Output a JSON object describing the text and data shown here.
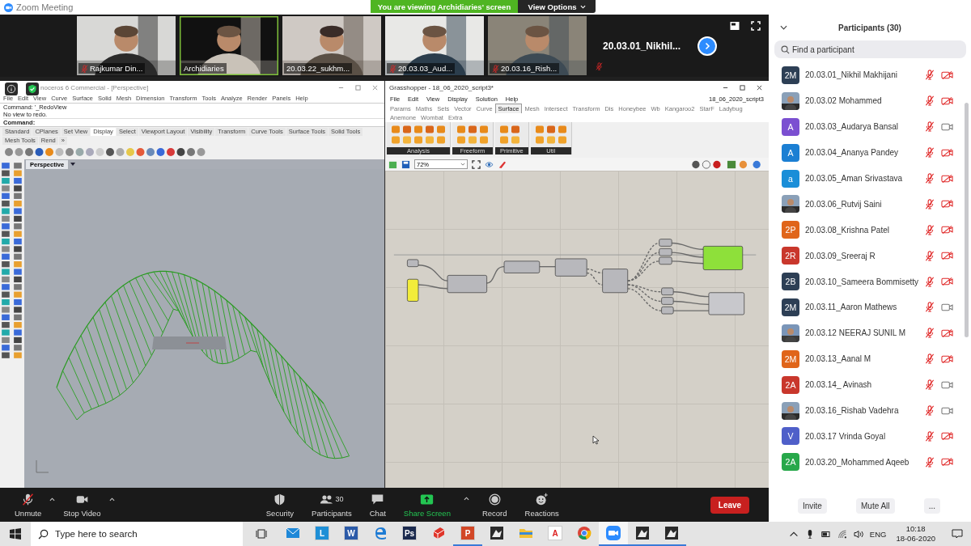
{
  "window": {
    "title": "Zoom Meeting"
  },
  "share_banner": {
    "text": "You are viewing Archidiaries' screen",
    "options": "View Options"
  },
  "video_tiles": [
    {
      "kind": "video",
      "name": "Rajkumar Din...",
      "muted": true,
      "speaking": false
    },
    {
      "kind": "video",
      "name": "Archidiaries",
      "muted": false,
      "speaking": true
    },
    {
      "kind": "video",
      "name": "20.03.22_sukhm...",
      "muted": false,
      "speaking": false
    },
    {
      "kind": "video",
      "name": "20.03.03_Aud...",
      "muted": true,
      "speaking": false
    },
    {
      "kind": "video",
      "name": "20.03.16_Rish...",
      "muted": true,
      "speaking": false
    },
    {
      "kind": "name",
      "name": "20.03.01_Nikhil...",
      "muted": true,
      "speaking": false
    }
  ],
  "rhino": {
    "title": "noceros 6 Commercial - [Perspective]",
    "menu": [
      "File",
      "Edit",
      "View",
      "Curve",
      "Surface",
      "Solid",
      "Mesh",
      "Dimension",
      "Transform",
      "Tools",
      "Analyze",
      "Render",
      "Panels",
      "Help"
    ],
    "command_history": [
      "Command: '_RedoView",
      "No view to redo."
    ],
    "command_prompt": "Command:",
    "tabs": [
      {
        "label": "Standard",
        "selected": false
      },
      {
        "label": "CPlanes",
        "selected": false
      },
      {
        "label": "Set View",
        "selected": false
      },
      {
        "label": "Display",
        "selected": true
      },
      {
        "label": "Select",
        "selected": false
      },
      {
        "label": "Viewport Layout",
        "selected": false
      },
      {
        "label": "Visibility",
        "selected": false
      },
      {
        "label": "Transform",
        "selected": false
      },
      {
        "label": "Curve Tools",
        "selected": false
      },
      {
        "label": "Surface Tools",
        "selected": false
      },
      {
        "label": "Solid Tools",
        "selected": false
      },
      {
        "label": "Mesh Tools",
        "selected": false
      },
      {
        "label": "Rend",
        "selected": false
      }
    ],
    "tabs_more": "»",
    "viewport": "Perspective"
  },
  "grasshopper": {
    "title": "Grasshopper - 18_06_2020_script3*",
    "menu": [
      "File",
      "Edit",
      "View",
      "Display",
      "Solution",
      "Help"
    ],
    "document": "18_06_2020_script3",
    "tabs": [
      {
        "label": "Params",
        "selected": false
      },
      {
        "label": "Maths",
        "selected": false
      },
      {
        "label": "Sets",
        "selected": false
      },
      {
        "label": "Vector",
        "selected": false
      },
      {
        "label": "Curve",
        "selected": false
      },
      {
        "label": "Surface",
        "selected": true
      },
      {
        "label": "Mesh",
        "selected": false
      },
      {
        "label": "Intersect",
        "selected": false
      },
      {
        "label": "Transform",
        "selected": false
      },
      {
        "label": "Dis",
        "selected": false
      },
      {
        "label": "Honeybee",
        "selected": false
      },
      {
        "label": "Wb",
        "selected": false
      },
      {
        "label": "Kangaroo2",
        "selected": false
      },
      {
        "label": "StarF",
        "selected": false
      },
      {
        "label": "Ladybug",
        "selected": false
      },
      {
        "label": "Anemone",
        "selected": false
      },
      {
        "label": "Wombat",
        "selected": false
      },
      {
        "label": "Extra",
        "selected": false
      }
    ],
    "groups": [
      {
        "label": "Analysis"
      },
      {
        "label": "Freeform"
      },
      {
        "label": "Primitive"
      },
      {
        "label": "Util"
      }
    ],
    "zoom": "72%"
  },
  "meeting_toolbar": {
    "left": [
      {
        "kind": "mic",
        "label": "Unmute",
        "muted": true,
        "caret": true
      },
      {
        "kind": "video",
        "label": "Stop Video",
        "muted": false,
        "caret": true
      }
    ],
    "center": [
      {
        "kind": "security",
        "label": "Security",
        "caret": false
      },
      {
        "kind": "participants",
        "label": "Participants",
        "count": "30",
        "caret": false
      },
      {
        "kind": "chat",
        "label": "Chat",
        "caret": false
      },
      {
        "kind": "share",
        "label": "Share Screen",
        "caret": true
      },
      {
        "kind": "record",
        "label": "Record",
        "caret": false
      },
      {
        "kind": "reactions",
        "label": "Reactions",
        "caret": false
      }
    ],
    "leave": "Leave"
  },
  "participants": {
    "title": "Participants (30)",
    "search_placeholder": "Find a participant",
    "list": [
      {
        "name": "20.03.01_Nikhil Makhijani",
        "avatar": {
          "kind": "initials",
          "text": "2M",
          "color": "#2d3f55"
        },
        "muted": true,
        "video": false
      },
      {
        "name": "20.03.02 Mohammed",
        "muted": true,
        "video": false
      },
      {
        "name": "20.03.03_Audarya Bansal",
        "avatar": {
          "kind": "initials",
          "text": "A",
          "color": "#7b4fd1"
        },
        "muted": true,
        "video": true
      },
      {
        "name": "20.03.04_Ananya Pandey",
        "avatar": {
          "kind": "initials",
          "text": "A",
          "color": "#1b7fd3"
        },
        "muted": true,
        "video": false
      },
      {
        "name": "20.03.05_Aman Srivastava",
        "avatar": {
          "kind": "initials",
          "text": "a",
          "color": "#1a8ed8"
        },
        "muted": true,
        "video": false
      },
      {
        "name": "20.03.06_Rutvij Saini",
        "muted": true,
        "video": false
      },
      {
        "name": "20.03.08_Krishna Patel",
        "avatar": {
          "kind": "initials",
          "text": "2P",
          "color": "#e0651a"
        },
        "muted": true,
        "video": false
      },
      {
        "name": "20.03.09_Sreeraj R",
        "avatar": {
          "kind": "initials",
          "text": "2R",
          "color": "#c9372c"
        },
        "muted": true,
        "video": false
      },
      {
        "name": "20.03.10_Sameera Bommisetty",
        "avatar": {
          "kind": "initials",
          "text": "2B",
          "color": "#2d3f55"
        },
        "muted": true,
        "video": false
      },
      {
        "name": "20.03.11_Aaron Mathews",
        "avatar": {
          "kind": "initials",
          "text": "2M",
          "color": "#2d3f55"
        },
        "muted": true,
        "video": true
      },
      {
        "name": "20.03.12 NEERAJ SUNIL M",
        "muted": true,
        "video": false
      },
      {
        "name": "20.03.13_Aanal M",
        "avatar": {
          "kind": "initials",
          "text": "2M",
          "color": "#e0651a"
        },
        "muted": true,
        "video": false
      },
      {
        "name": "20.03.14_ Avinash",
        "avatar": {
          "kind": "initials",
          "text": "2A",
          "color": "#c9372c"
        },
        "muted": true,
        "video": true
      },
      {
        "name": "20.03.16_Rishab Vadehra",
        "muted": true,
        "video": true
      },
      {
        "name": "20.03.17 Vrinda Goyal",
        "avatar": {
          "kind": "initials",
          "text": "V",
          "color": "#4f5fc9"
        },
        "muted": true,
        "video": false
      },
      {
        "name": "20.03.20_Mohammed Aqeeb",
        "avatar": {
          "kind": "initials",
          "text": "2A",
          "color": "#27a84a"
        },
        "muted": true,
        "video": false
      }
    ],
    "buttons": [
      "Invite",
      "Mute All",
      "..."
    ]
  },
  "taskbar": {
    "search_placeholder": "Type here to search",
    "apps": [
      {
        "kind": "mail",
        "running": false,
        "selected": false
      },
      {
        "kind": "letter",
        "label": "L",
        "color": "#1e8fd6",
        "running": false,
        "selected": false
      },
      {
        "kind": "letter",
        "label": "W",
        "color": "#2b5aa8",
        "running": false,
        "selected": false
      },
      {
        "kind": "edge",
        "running": false,
        "selected": false
      },
      {
        "kind": "letter",
        "label": "Ps",
        "color": "#1b2a4e",
        "running": false,
        "selected": false
      },
      {
        "kind": "sketchup",
        "running": false,
        "selected": false
      },
      {
        "kind": "letter",
        "label": "P",
        "color": "#d24726",
        "running": true,
        "selected": false
      },
      {
        "kind": "rhino",
        "running": false,
        "selected": false
      },
      {
        "kind": "folder",
        "running": false,
        "selected": false
      },
      {
        "kind": "letter",
        "label": "A",
        "color": "#ffffff",
        "running": false,
        "selected": false
      },
      {
        "kind": "chrome",
        "running": false,
        "selected": false
      },
      {
        "kind": "zoom",
        "running": true,
        "selected": true
      },
      {
        "kind": "rhino",
        "running": true,
        "selected": false
      },
      {
        "kind": "rhino",
        "running": true,
        "selected": false
      }
    ],
    "language": "ENG",
    "time": "10:18",
    "date": "18-06-2020"
  }
}
